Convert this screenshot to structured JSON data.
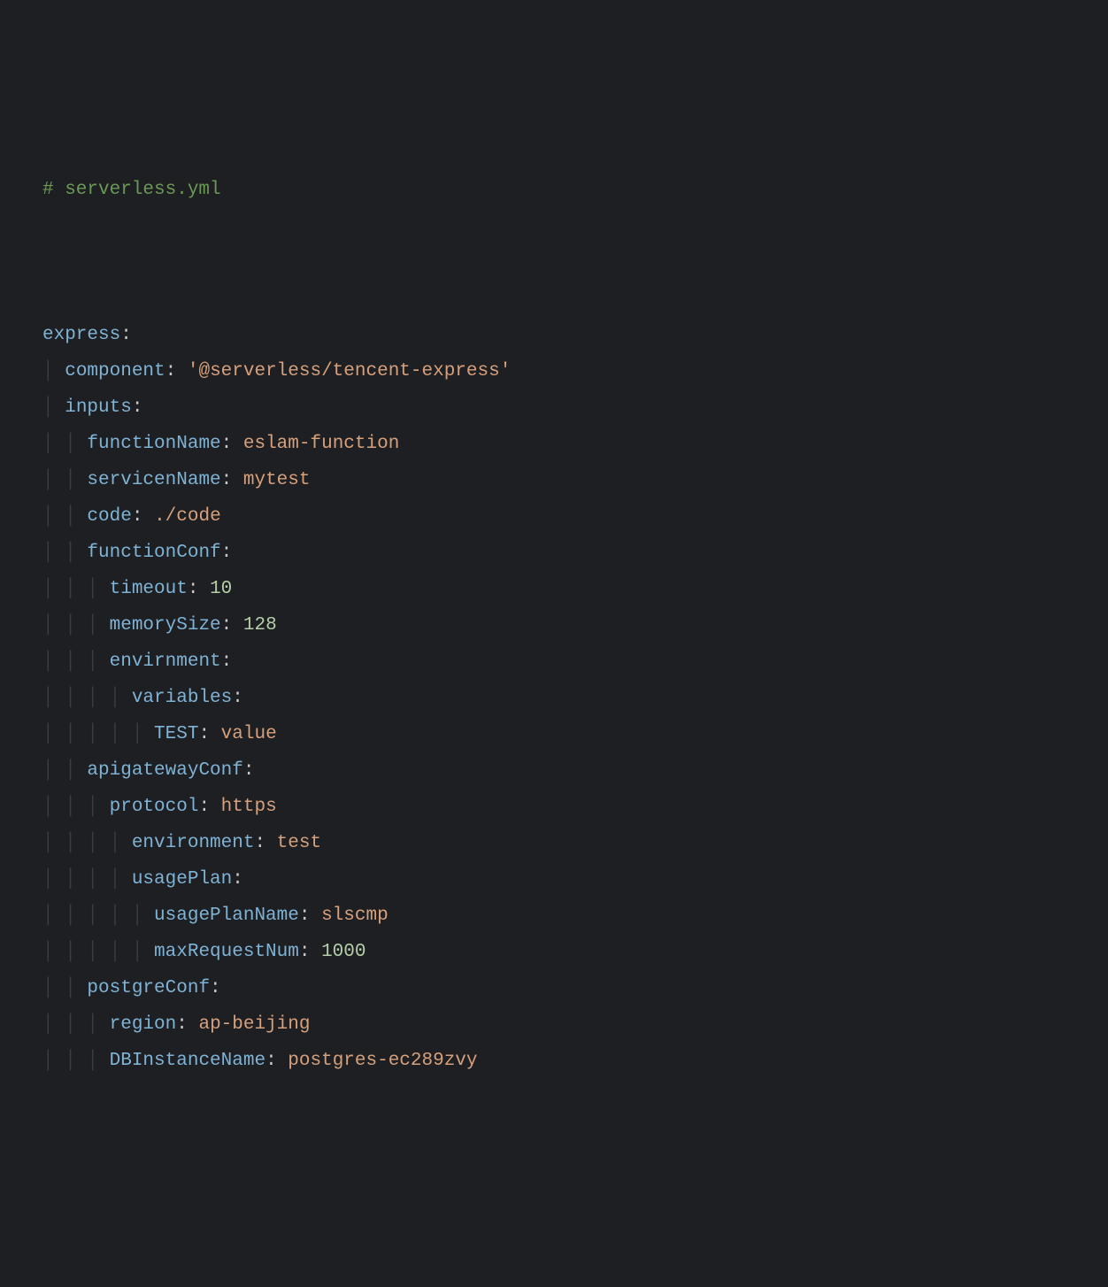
{
  "code": {
    "comment": "# serverless.yml",
    "lines": [
      {
        "indent": 0,
        "key": "express",
        "value": null
      },
      {
        "indent": 1,
        "key": "component",
        "value": "'@serverless/tencent-express'",
        "vtype": "string"
      },
      {
        "indent": 1,
        "key": "inputs",
        "value": null
      },
      {
        "indent": 2,
        "key": "functionName",
        "value": "eslam-function",
        "vtype": "string"
      },
      {
        "indent": 2,
        "key": "servicenName",
        "value": "mytest",
        "vtype": "string"
      },
      {
        "indent": 2,
        "key": "code",
        "value": "./code",
        "vtype": "string"
      },
      {
        "indent": 2,
        "key": "functionConf",
        "value": null
      },
      {
        "indent": 3,
        "key": "timeout",
        "value": "10",
        "vtype": "number"
      },
      {
        "indent": 3,
        "key": "memorySize",
        "value": "128",
        "vtype": "number"
      },
      {
        "indent": 3,
        "key": "envirnment",
        "value": null
      },
      {
        "indent": 4,
        "key": "variables",
        "value": null
      },
      {
        "indent": 5,
        "key": "TEST",
        "value": "value",
        "vtype": "string"
      },
      {
        "indent": 2,
        "key": "apigatewayConf",
        "value": null
      },
      {
        "indent": 3,
        "key": "protocol",
        "value": "https",
        "vtype": "string"
      },
      {
        "indent": 4,
        "key": "environment",
        "value": "test",
        "vtype": "string"
      },
      {
        "indent": 4,
        "key": "usagePlan",
        "value": null
      },
      {
        "indent": 5,
        "key": "usagePlanName",
        "value": "slscmp",
        "vtype": "string"
      },
      {
        "indent": 5,
        "key": "maxRequestNum",
        "value": "1000",
        "vtype": "number"
      },
      {
        "indent": 2,
        "key": "postgreConf",
        "value": null
      },
      {
        "indent": 3,
        "key": "region",
        "value": "ap-beijing",
        "vtype": "string"
      },
      {
        "indent": 3,
        "key": "DBInstanceName",
        "value": "postgres-ec289zvy",
        "vtype": "string"
      }
    ]
  }
}
